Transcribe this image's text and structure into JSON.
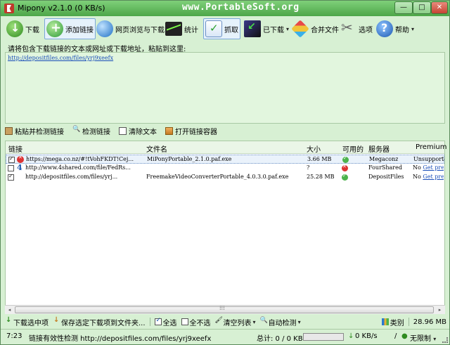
{
  "window": {
    "title": "Mipony v2.1.0 (0 KB/s)",
    "watermark": "www.PortableSoft.org",
    "controls": {
      "min": "—",
      "max": "□",
      "close": "✕"
    }
  },
  "toolbar": {
    "download": "下载",
    "add_link": "添加链接",
    "browse": "网页浏览与下载",
    "stats": "统计",
    "grab": "抓取",
    "downloaded": "已下载",
    "merge": "合并文件",
    "options": "选项",
    "help": "帮助",
    "dropdown_glyph": "▾"
  },
  "paste": {
    "label": "请将包含下载链接的文本或网址或下载地址，粘贴到这里:",
    "content": "http://depositfiles.com/files/yrj9xeefx"
  },
  "midbar": {
    "paste_check": "粘贴并检测链接",
    "check_links": "检测链接",
    "clear_text": "清除文本",
    "open_container": "打开链接容器"
  },
  "table": {
    "headers": {
      "link": "链接",
      "filename": "文件名",
      "size": "大小",
      "available": "可用的",
      "server": "服务器",
      "premium": "Premium"
    },
    "rows": [
      {
        "checked": true,
        "status_icon": "error-icon",
        "link": "https://mega.co.nz/#!tVohFKDT!Cej...",
        "filename": "MiPonyPortable_2.1.0.paf.exe",
        "size": "3.66 MB",
        "available": "ok",
        "server": "Megaconz",
        "premium_prefix": "",
        "premium_link": "Unsupported"
      },
      {
        "checked": false,
        "status_icon": "fourshared-icon",
        "link": "http://www.4shared.com/file/FedRs...",
        "filename": "",
        "size": "?",
        "available": "bad",
        "server": "FourShared",
        "premium_prefix": "No",
        "premium_link": "Get prem"
      },
      {
        "checked": true,
        "status_icon": "none",
        "link": "http://depositfiles.com/files/yrj...",
        "filename": "FreemakeVideoConverterPortable_4.0.3.0.paf.exe",
        "size": "25.28 MB",
        "available": "ok",
        "server": "DepositFiles",
        "premium_prefix": "No",
        "premium_link": "Get prem"
      }
    ]
  },
  "scroll": {
    "left": "◂",
    "right": "▸",
    "grip": "⁞⁞⁞"
  },
  "bottombar": {
    "download_selected": "下载选中项",
    "save_selected": "保存选定下载项到文件夹...",
    "select_all": "全选",
    "select_none": "全不选",
    "clear_list": "清空列表",
    "auto_check": "自动检测",
    "category": "类别",
    "total_size": "28.96 MB",
    "dropdown_glyph": "▾"
  },
  "status": {
    "time": "7:23",
    "message": "链接有效性检测 http://depositfiles.com/files/yrj9xeefx",
    "total": "总计: 0 / 0 KB",
    "speed": "0 KB/s",
    "slash": "/",
    "limit": "无限制",
    "dropdown_glyph": "▾"
  },
  "colors": {
    "accent": "#4da648",
    "window_bg": "#d7f0d3",
    "link": "#1a4eb8"
  }
}
